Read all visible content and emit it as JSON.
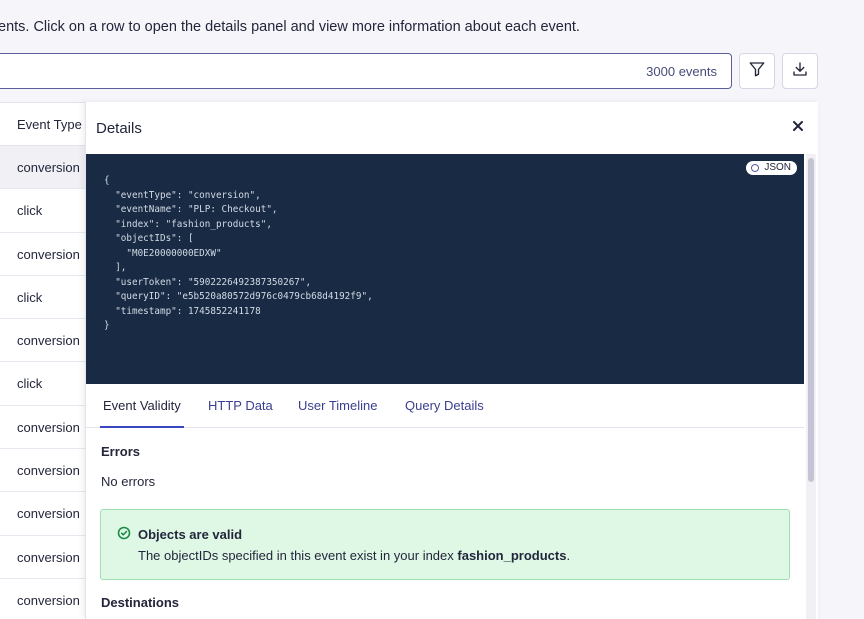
{
  "intro": {
    "text": "ents. Click on a row to open the details panel and view more information about each event."
  },
  "search": {
    "count_label": "3000 events"
  },
  "toolbar": {
    "filter_icon": "filter-icon",
    "download_icon": "download-icon"
  },
  "table": {
    "header": "Event Type",
    "rows": [
      "conversion",
      "click",
      "conversion",
      "click",
      "conversion",
      "click",
      "conversion",
      "conversion",
      "conversion",
      "conversion",
      "conversion"
    ]
  },
  "details": {
    "title": "Details",
    "close_icon": "close-icon",
    "json_badge": "JSON",
    "json_text": "{\n  \"eventType\": \"conversion\",\n  \"eventName\": \"PLP: Checkout\",\n  \"index\": \"fashion_products\",\n  \"objectIDs\": [\n    \"M0E20000000EDXW\"\n  ],\n  \"userToken\": \"5902226492387350267\",\n  \"queryID\": \"e5b520a80572d976c0479cb68d4192f9\",\n  \"timestamp\": 1745852241178\n}",
    "tabs": [
      {
        "label": "Event Validity",
        "active": true
      },
      {
        "label": "HTTP Data",
        "active": false
      },
      {
        "label": "User Timeline",
        "active": false
      },
      {
        "label": "Query Details",
        "active": false
      }
    ],
    "errors_title": "Errors",
    "errors_text": "No errors",
    "valid": {
      "title": "Objects are valid",
      "text_prefix": "The objectIDs specified in this event exist in your index ",
      "index_name": "fashion_products",
      "text_suffix": "."
    },
    "destinations_title": "Destinations"
  },
  "colors": {
    "code_bg": "#182a44",
    "accent": "#3a46bf",
    "success_bg": "#dff8e6",
    "success_icon": "#1d8a45"
  }
}
